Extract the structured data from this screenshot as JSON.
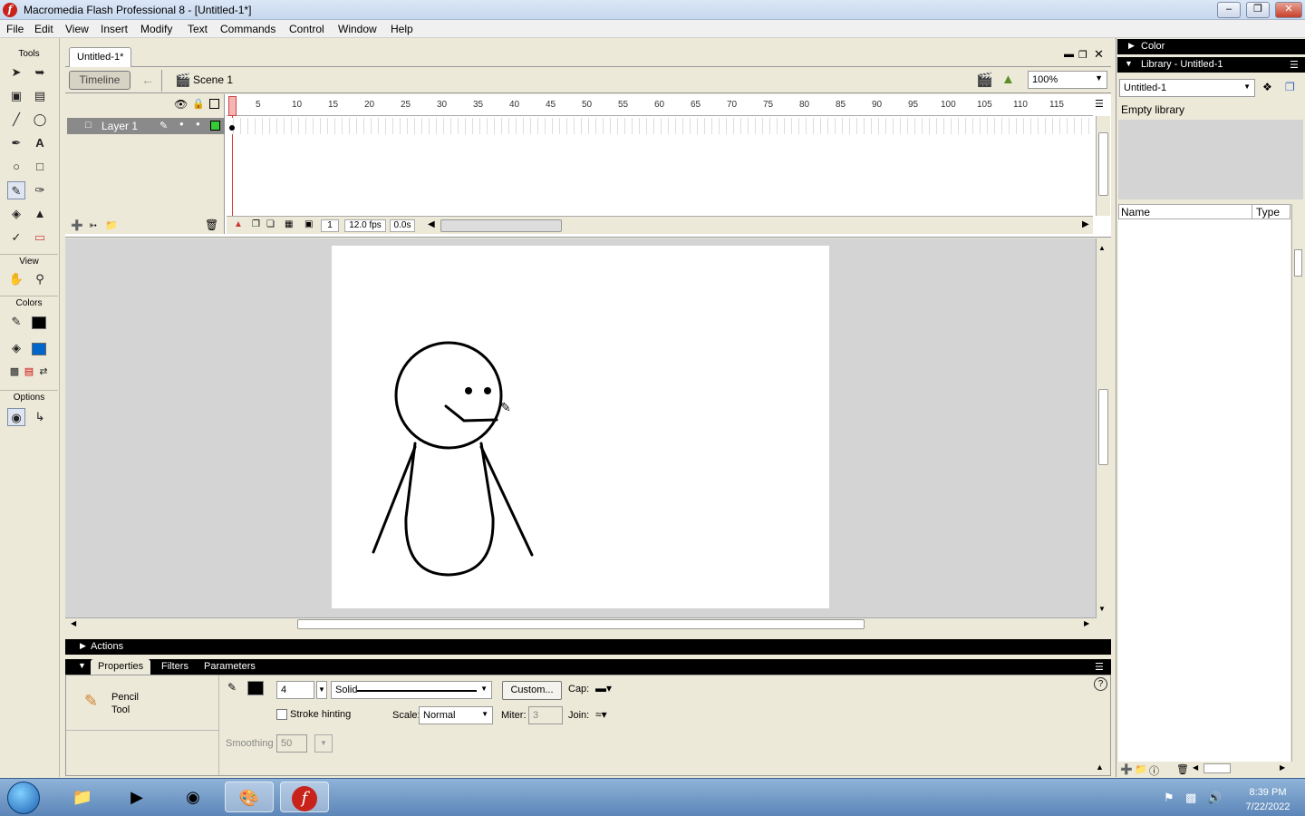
{
  "window": {
    "title": "Macromedia Flash Professional 8 - [Untitled-1*]",
    "app_icon": "flash-icon"
  },
  "menu": [
    "File",
    "Edit",
    "View",
    "Insert",
    "Modify",
    "Text",
    "Commands",
    "Control",
    "Window",
    "Help"
  ],
  "tools": {
    "label": "Tools",
    "view_label": "View",
    "colors_label": "Colors",
    "options_label": "Options"
  },
  "document": {
    "tab": "Untitled-1*",
    "timeline_button": "Timeline",
    "scene": "Scene 1",
    "zoom": "100%"
  },
  "timeline": {
    "layer_name": "Layer 1",
    "ruler": [
      "5",
      "10",
      "15",
      "20",
      "25",
      "30",
      "35",
      "40",
      "45",
      "50",
      "55",
      "60",
      "65",
      "70",
      "75",
      "80",
      "85",
      "90",
      "95",
      "100",
      "105",
      "110",
      "115"
    ],
    "current_frame": "1",
    "fps": "12.0 fps",
    "elapsed": "0.0s"
  },
  "panels": {
    "actions": "Actions",
    "tabs": [
      "Properties",
      "Filters",
      "Parameters"
    ],
    "tool_name_1": "Pencil",
    "tool_name_2": "Tool",
    "stroke_width": "4",
    "stroke_style": "Solid",
    "custom_button": "Custom...",
    "cap_label": "Cap:",
    "stroke_hinting": "Stroke hinting",
    "scale_label": "Scale:",
    "scale_value": "Normal",
    "miter_label": "Miter:",
    "miter_value": "3",
    "join_label": "Join:",
    "smoothing_label": "Smoothing",
    "smoothing_value": "50"
  },
  "right": {
    "color_header": "Color",
    "library_header": "Library - Untitled-1",
    "library_select": "Untitled-1",
    "empty_text": "Empty library",
    "col_name": "Name",
    "col_type": "Type"
  },
  "taskbar": {
    "time": "8:39 PM",
    "date": "7/22/2022"
  },
  "colors": {
    "stroke": "#000000",
    "fill": "#0066cc",
    "accent": "#c8231b"
  }
}
